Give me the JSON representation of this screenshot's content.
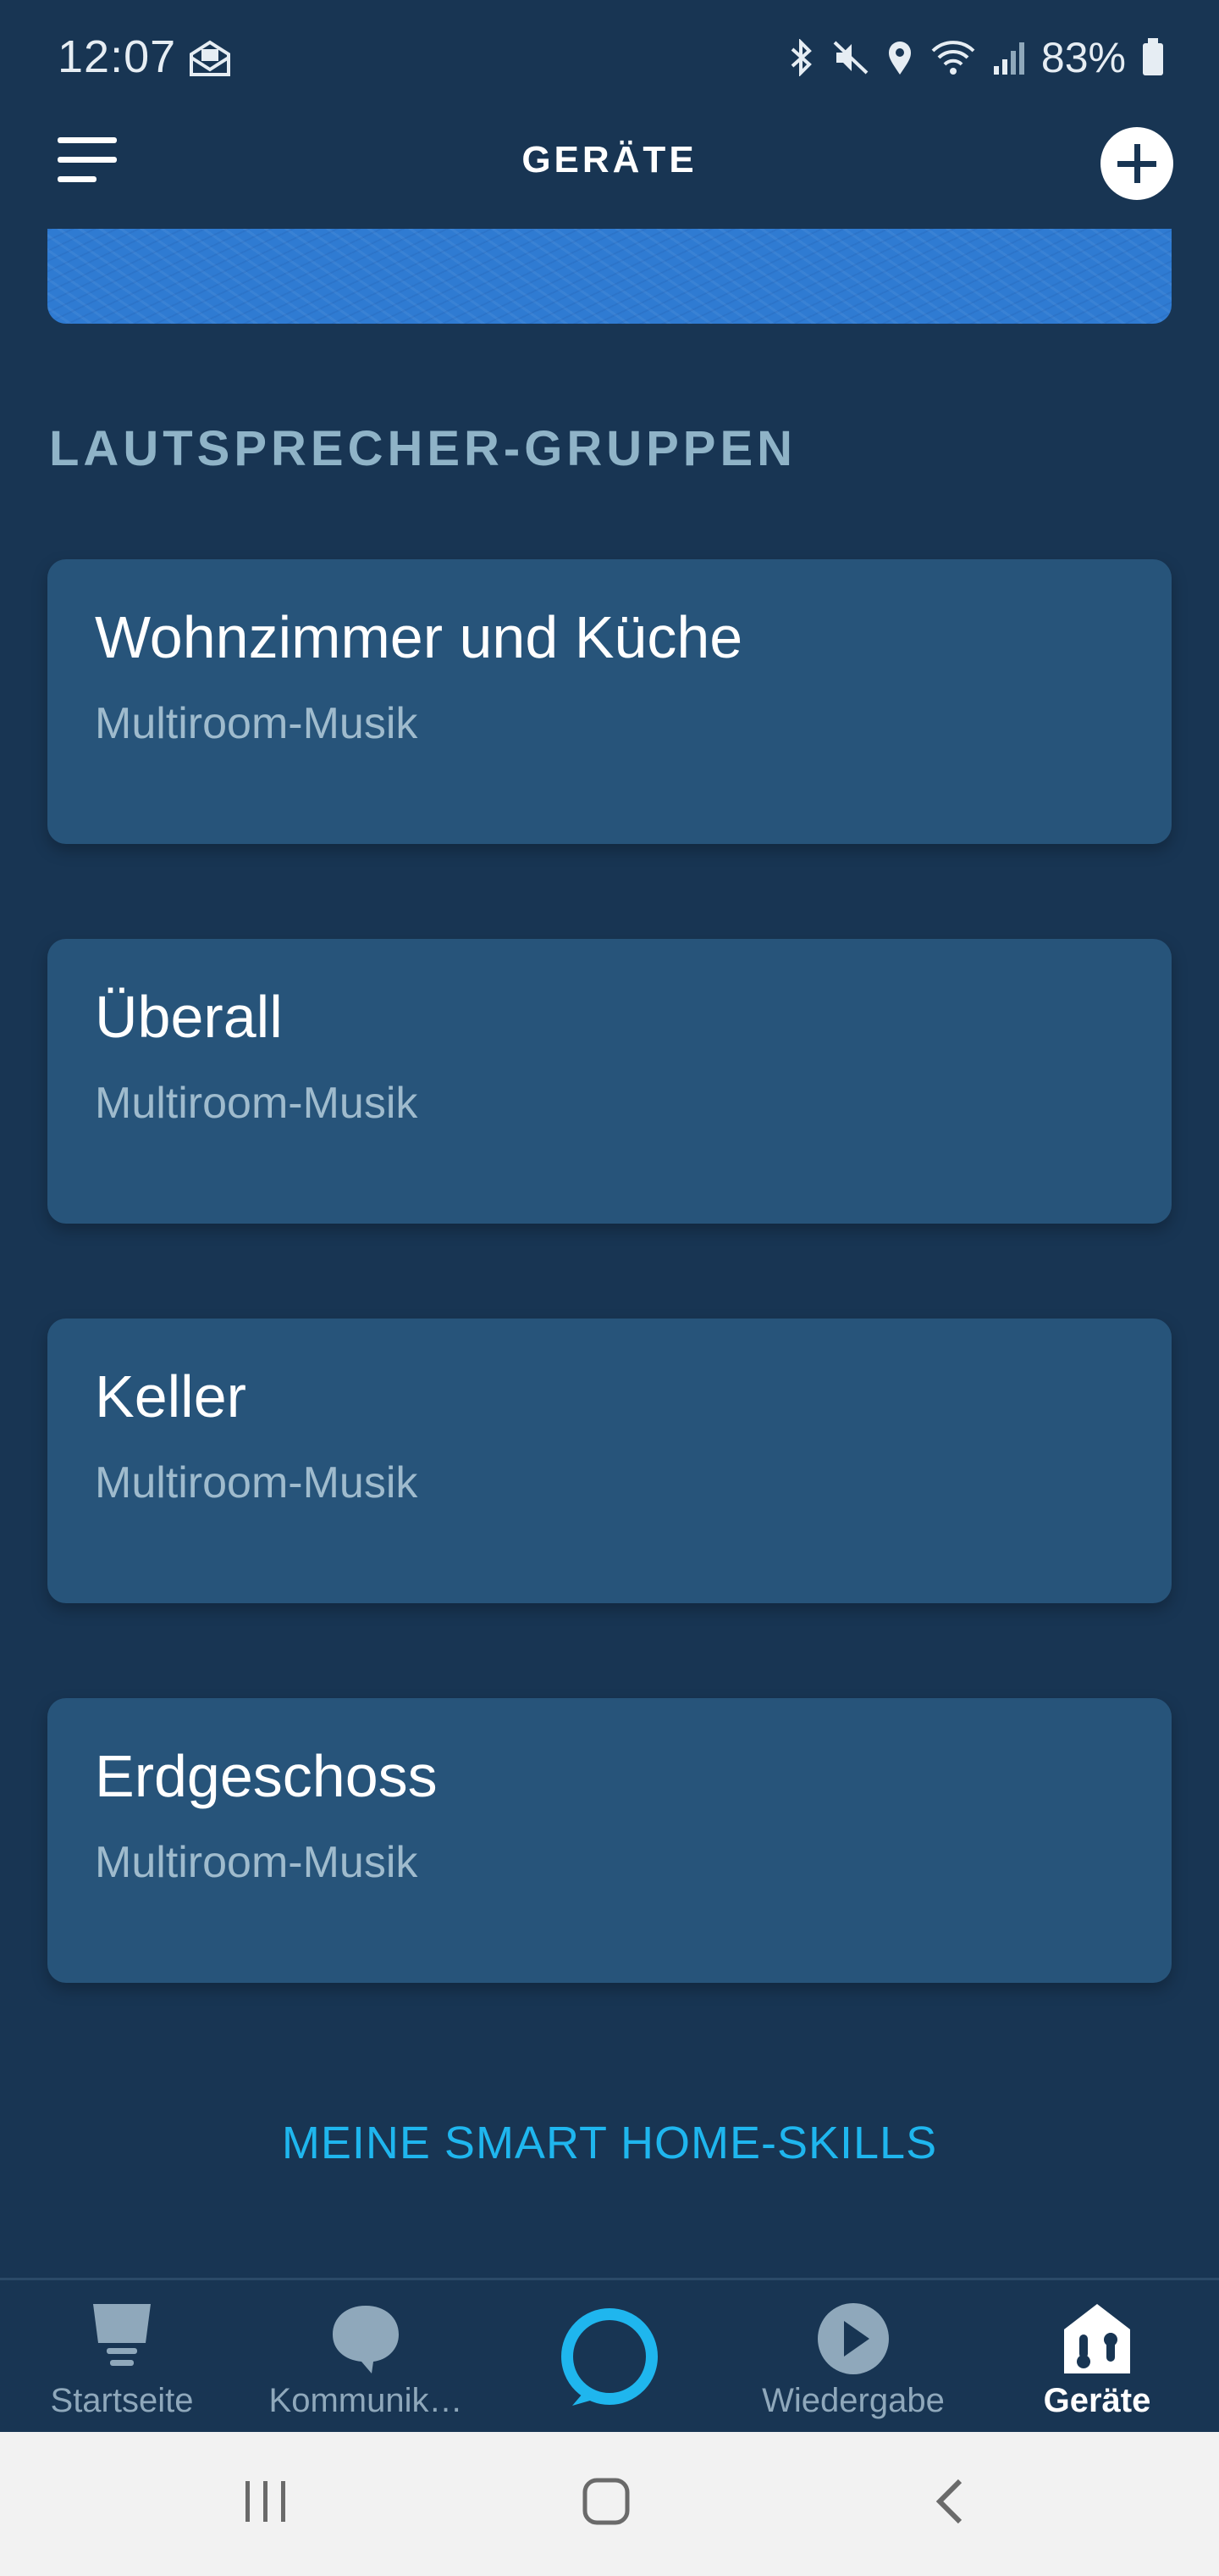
{
  "status_bar": {
    "time": "12:07",
    "battery": "83%",
    "icons": [
      "mail-icon",
      "bluetooth-icon",
      "mute-icon",
      "location-icon",
      "wifi-icon",
      "signal-icon",
      "battery-icon"
    ]
  },
  "header": {
    "title": "GERÄTE",
    "menu_icon": "menu-icon",
    "add_icon": "plus-icon"
  },
  "section": {
    "title": "LAUTSPRECHER-GRUPPEN"
  },
  "groups": [
    {
      "name": "Wohnzimmer und Küche",
      "type": "Multiroom-Musik"
    },
    {
      "name": "Überall",
      "type": "Multiroom-Musik"
    },
    {
      "name": "Keller",
      "type": "Multiroom-Musik"
    },
    {
      "name": "Erdgeschoss",
      "type": "Multiroom-Musik"
    }
  ],
  "smart_home_link": "MEINE SMART HOME-SKILLS",
  "bottom_nav": {
    "items": [
      {
        "label": "Startseite",
        "icon": "home-icon"
      },
      {
        "label": "Kommunik…",
        "icon": "chat-bubble-icon"
      },
      {
        "label": "",
        "icon": "alexa-ring-icon"
      },
      {
        "label": "Wiedergabe",
        "icon": "play-icon"
      },
      {
        "label": "Geräte",
        "icon": "devices-house-icon",
        "active": true
      }
    ]
  },
  "colors": {
    "background": "#183553",
    "card": "#27547a",
    "banner": "#2f7bd2",
    "accent": "#1fb6ee",
    "section_title": "#8fb3c7"
  }
}
